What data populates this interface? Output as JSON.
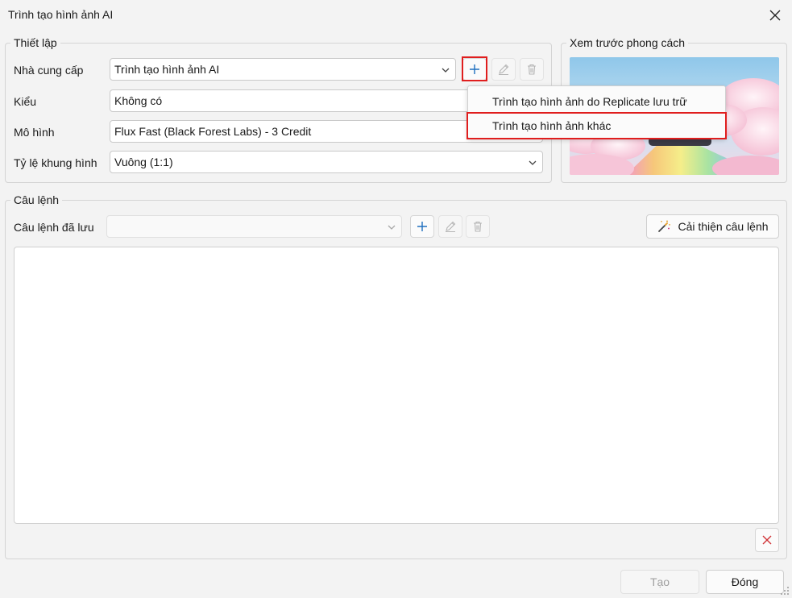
{
  "window": {
    "title": "Trình tạo hình ảnh AI",
    "close_icon": "close-icon"
  },
  "settings": {
    "legend": "Thiết lập",
    "provider": {
      "label": "Nhà cung cấp",
      "value": "Trình tạo hình ảnh AI"
    },
    "style": {
      "label": "Kiểu",
      "value": "Không có"
    },
    "model": {
      "label": "Mô hình",
      "value": "Flux Fast (Black Forest Labs) - 3 Credit"
    },
    "aspect": {
      "label": "Tỷ lệ khung hình",
      "value": "Vuông (1:1)"
    }
  },
  "add_menu": {
    "items": [
      {
        "label": "Trình tạo hình ảnh do Replicate lưu trữ"
      },
      {
        "label": "Trình tạo hình ảnh khác"
      }
    ]
  },
  "preview": {
    "legend": "Xem trước phong cách"
  },
  "prompt": {
    "legend": "Câu lệnh",
    "saved_label": "Câu lệnh đã lưu",
    "saved_value": "",
    "improve_label": "Cải thiện câu lệnh",
    "text": ""
  },
  "footer": {
    "create_label": "Tạo",
    "close_label": "Đóng"
  },
  "colors": {
    "accent": "#1f6fbf",
    "highlight": "#e01e1e",
    "danger": "#d13438"
  }
}
